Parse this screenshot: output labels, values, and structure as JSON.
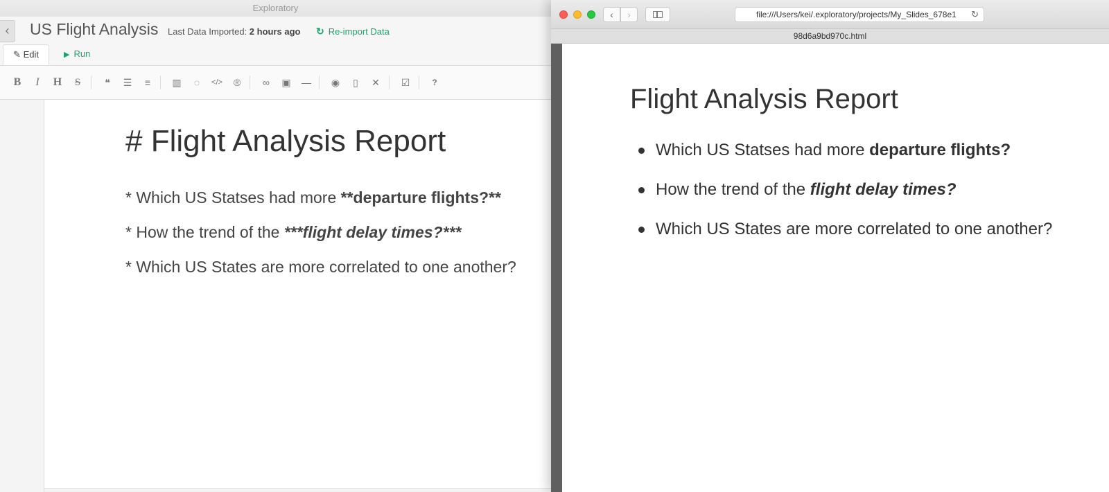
{
  "left_app": {
    "window_title": "Exploratory",
    "back_glyph": "‹",
    "project_title": "US Flight Analysis",
    "import_label": "Last Data Imported:",
    "import_time": "2 hours ago",
    "reimport_label": "Re-import Data",
    "reimport_icon": "↻",
    "tabs": {
      "edit": "Edit",
      "edit_icon": "✎",
      "run": "Run",
      "run_icon": "▶"
    },
    "toolbar_icons": [
      {
        "name": "bold-icon",
        "glyph": "B"
      },
      {
        "name": "italic-icon",
        "glyph": "I"
      },
      {
        "name": "heading-icon",
        "glyph": "H"
      },
      {
        "name": "strikethrough-icon",
        "glyph": "S"
      },
      {
        "name": "quote-icon",
        "glyph": "❝"
      },
      {
        "name": "unordered-list-icon",
        "glyph": "☰"
      },
      {
        "name": "ordered-list-icon",
        "glyph": "≡"
      },
      {
        "name": "chart-icon",
        "glyph": "▥"
      },
      {
        "name": "lightbulb-icon",
        "glyph": "◌"
      },
      {
        "name": "code-icon",
        "glyph": "</>"
      },
      {
        "name": "r-icon",
        "glyph": "®"
      },
      {
        "name": "link-icon",
        "glyph": "∞"
      },
      {
        "name": "image-icon",
        "glyph": "▣"
      },
      {
        "name": "horizontal-rule-icon",
        "glyph": "—"
      },
      {
        "name": "preview-icon",
        "glyph": "◉"
      },
      {
        "name": "side-by-side-icon",
        "glyph": "▯"
      },
      {
        "name": "fullscreen-icon",
        "glyph": "✕"
      },
      {
        "name": "checklist-icon",
        "glyph": "☑"
      },
      {
        "name": "help-icon",
        "glyph": "?"
      }
    ],
    "markdown": {
      "heading": "# Flight Analysis Report",
      "line1_prefix": "* Which US Statses had more ",
      "line1_strong": "**departure flights?**",
      "line2_prefix": "* How the trend of the ",
      "line2_strong_em": "***flight delay times?***",
      "line3": "* Which US States are more correlated to one another?"
    }
  },
  "browser": {
    "url": "file:///Users/kei/.exploratory/projects/My_Slides_678e1",
    "tab_title": "98d6a9bd970c.html",
    "back_glyph": "‹",
    "forward_glyph": "›",
    "reload_glyph": "↻",
    "traffic_colors": {
      "close": "#fc5f57",
      "minimize": "#fdbc2e",
      "maximize": "#28c840"
    }
  },
  "slide": {
    "title": "Flight Analysis Report",
    "bullet1_prefix": "Which US Statses had more ",
    "bullet1_strong": "departure flights?",
    "bullet2_prefix": "How the trend of the ",
    "bullet2_strong_em": "flight delay times?",
    "bullet3": "Which US States are more correlated to one another?"
  },
  "colors": {
    "accent_green": "#1ea26b",
    "text_dark": "#333333"
  }
}
